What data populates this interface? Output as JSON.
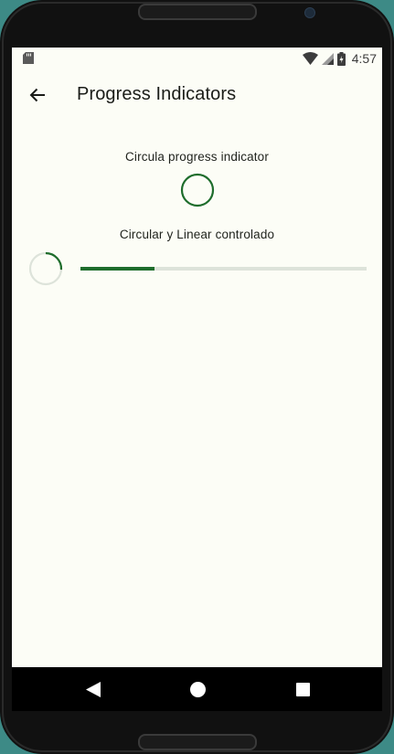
{
  "status_bar": {
    "time": "4:57",
    "icons": [
      "sd-card-icon",
      "wifi-icon",
      "cell-signal-icon",
      "battery-charging-icon"
    ]
  },
  "app_bar": {
    "back_icon": "arrow-back-icon",
    "title": "Progress Indicators"
  },
  "content": {
    "circular_label": "Circula progress indicator",
    "controlled_label": "Circular y Linear controlado",
    "controlled_progress": 0.26
  },
  "nav_bar": {
    "icons": [
      "nav-back-icon",
      "nav-home-icon",
      "nav-recents-icon"
    ]
  },
  "colors": {
    "accent": "#1e6d2c",
    "track": "#dde3da",
    "background": "#fcfdf6"
  }
}
